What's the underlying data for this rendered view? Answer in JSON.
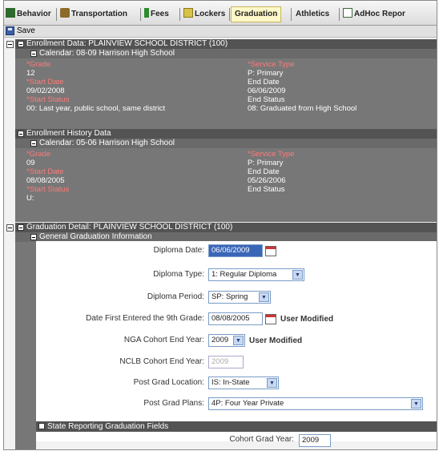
{
  "tabs": [
    {
      "label": "Behavior",
      "icon": "behavior-icon"
    },
    {
      "label": "Transportation",
      "icon": "bus-icon"
    },
    {
      "label": "Fees",
      "icon": "fees-icon"
    },
    {
      "label": "Lockers",
      "icon": "lock-icon"
    },
    {
      "label": "Graduation",
      "icon": "",
      "active": true
    },
    {
      "label": "Athletics",
      "icon": ""
    },
    {
      "label": "AdHoc Repor",
      "icon": "report-icon"
    }
  ],
  "toolbar": {
    "save_label": "Save"
  },
  "enrollment": {
    "header": "Enrollment Data: PLAINVIEW SCHOOL DISTRICT (100)",
    "calendar": "Calendar: 08-09 Harrison High School",
    "grade_label": "*Grade",
    "grade": "12",
    "service_type_label": "*Service Type",
    "service_type": "P: Primary",
    "start_date_label": "*Start Date",
    "start_date": "09/02/2008",
    "end_date_label": "End Date",
    "end_date": "06/06/2009",
    "start_status_label": "*Start Status",
    "start_status": "00: Last year, public school, same district",
    "end_status_label": "End Status",
    "end_status": "08: Graduated from High School"
  },
  "history": {
    "header": "Enrollment History Data",
    "calendar": "Calendar: 05-06 Harrison High School",
    "grade_label": "*Grade",
    "grade": "09",
    "service_type_label": "*Service Type",
    "service_type": "P: Primary",
    "start_date_label": "*Start Date",
    "start_date": "08/08/2005",
    "end_date_label": "End Date",
    "end_date": "05/26/2006",
    "start_status_label": "*Start Status",
    "start_status": "U:",
    "end_status_label": "End Status"
  },
  "graduation": {
    "header": "Graduation Detail: PLAINVIEW SCHOOL DISTRICT (100)",
    "general_header": "General Graduation Information",
    "diploma_date_label": "Diploma Date:",
    "diploma_date": "06/06/2009",
    "diploma_type_label": "Diploma Type:",
    "diploma_type": "1: Regular Diploma",
    "diploma_period_label": "Diploma Period:",
    "diploma_period": "SP: Spring",
    "first_9th_label": "Date First Entered the 9th Grade:",
    "first_9th": "08/08/2005",
    "user_modified": "User Modified",
    "nga_label": "NGA Cohort End Year:",
    "nga_year": "2009",
    "nclb_label": "NCLB Cohort End Year:",
    "nclb_year": "2009",
    "location_label": "Post Grad Location:",
    "location": "IS: In-State",
    "plans_label": "Post Grad Plans:",
    "plans": "4P: Four Year Private",
    "state_header": "State Reporting Graduation Fields",
    "cohort_label": "Cohort Grad Year:",
    "cohort_year": "2009"
  }
}
